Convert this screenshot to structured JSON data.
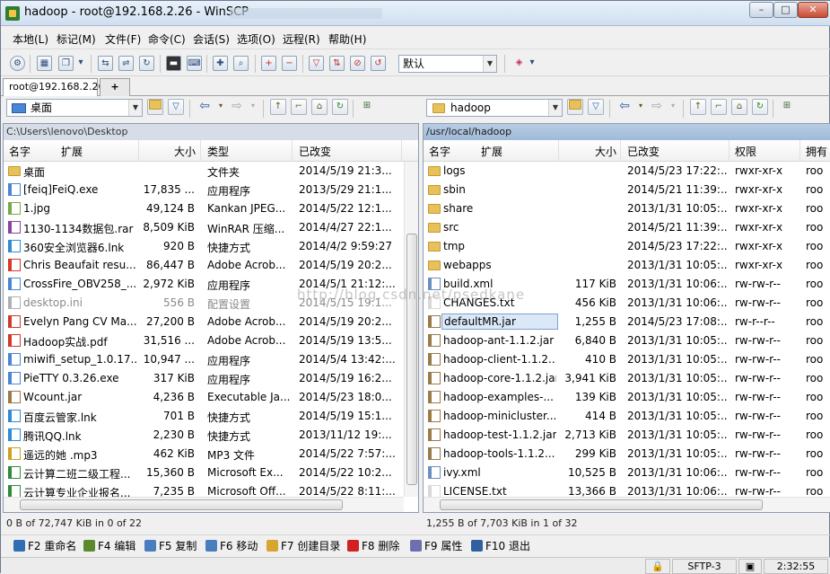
{
  "window": {
    "title": "hadoop - root@192.168.2.26 - WinSCP",
    "min": "–",
    "max": "□",
    "close": "✕"
  },
  "menu": [
    "本地(L)",
    "标记(M)",
    "文件(F)",
    "命令(C)",
    "会话(S)",
    "选项(O)",
    "远程(R)",
    "帮助(H)"
  ],
  "toolbar": {
    "transfer_setting": "默认"
  },
  "session_tab": {
    "label": "root@192.168.2.26",
    "new_tab": "+"
  },
  "left": {
    "drive": "桌面",
    "path": "C:\\Users\\lenovo\\Desktop",
    "columns": [
      "名字",
      "扩展",
      "大小",
      "类型",
      "已改变"
    ],
    "rows": [
      {
        "name": "桌面",
        "size": "",
        "type": "文件夹",
        "date": "2014/5/19  21:3...",
        "icon": "folder"
      },
      {
        "name": "[feiq]FeiQ.exe",
        "size": "17,835 ...",
        "type": "应用程序",
        "date": "2013/5/29  21:1...",
        "icon": "app"
      },
      {
        "name": "1.jpg",
        "size": "49,124 B",
        "type": "Kankan JPEG...",
        "date": "2014/5/22  12:1...",
        "icon": "image"
      },
      {
        "name": "1130-1134数据包.rar",
        "size": "8,509 KiB",
        "type": "WinRAR 压缩...",
        "date": "2014/4/27  22:1...",
        "icon": "rar"
      },
      {
        "name": "360安全浏览器6.lnk",
        "size": "920 B",
        "type": "快捷方式",
        "date": "2014/4/2  9:59:27",
        "icon": "lnk"
      },
      {
        "name": "Chris Beaufait resu...",
        "size": "86,447 B",
        "type": "Adobe Acrob...",
        "date": "2014/5/19  20:2...",
        "icon": "pdf"
      },
      {
        "name": "CrossFire_OBV258_...",
        "size": "2,972 KiB",
        "type": "应用程序",
        "date": "2014/5/1  21:12:...",
        "icon": "app"
      },
      {
        "name": "desktop.ini",
        "size": "556 B",
        "type": "配置设置",
        "date": "2014/5/15  19:1...",
        "icon": "ini",
        "hidden": true
      },
      {
        "name": "Evelyn Pang CV Ma...",
        "size": "27,200 B",
        "type": "Adobe Acrob...",
        "date": "2014/5/19  20:2...",
        "icon": "pdf"
      },
      {
        "name": "Hadoop实战.pdf",
        "size": "31,516 ...",
        "type": "Adobe Acrob...",
        "date": "2014/5/19  13:5...",
        "icon": "pdf"
      },
      {
        "name": "miwifi_setup_1.0.17...",
        "size": "10,947 ...",
        "type": "应用程序",
        "date": "2014/5/4  13:42:...",
        "icon": "app"
      },
      {
        "name": "PieTTY 0.3.26.exe",
        "size": "317 KiB",
        "type": "应用程序",
        "date": "2014/5/19  16:2...",
        "icon": "app"
      },
      {
        "name": "Wcount.jar",
        "size": "4,236 B",
        "type": "Executable Ja...",
        "date": "2014/5/23  18:0...",
        "icon": "jar"
      },
      {
        "name": "百度云管家.lnk",
        "size": "701 B",
        "type": "快捷方式",
        "date": "2014/5/19  15:1...",
        "icon": "lnk"
      },
      {
        "name": "腾讯QQ.lnk",
        "size": "2,230 B",
        "type": "快捷方式",
        "date": "2013/11/12  19:...",
        "icon": "lnk"
      },
      {
        "name": "遥远的她 .mp3",
        "size": "462 KiB",
        "type": "MP3 文件",
        "date": "2014/5/22  7:57:...",
        "icon": "mp3"
      },
      {
        "name": "云计算二班二级工程...",
        "size": "15,360 B",
        "type": "Microsoft Ex...",
        "date": "2014/5/22  10:2...",
        "icon": "xls"
      },
      {
        "name": "云计算专业企业报名...",
        "size": "7,235 B",
        "type": "Microsoft Off...",
        "date": "2014/5/22  8:11:...",
        "icon": "xls"
      }
    ],
    "status": "0 B of 72,747 KiB in 0 of 22"
  },
  "right": {
    "drive": "hadoop",
    "path": "/usr/local/hadoop",
    "columns": [
      "名字",
      "扩展",
      "大小",
      "已改变",
      "权限",
      "拥有"
    ],
    "rows": [
      {
        "name": "logs",
        "size": "",
        "date": "2014/5/23  17:22:...",
        "perm": "rwxr-xr-x",
        "owner": "roo",
        "icon": "folder"
      },
      {
        "name": "sbin",
        "size": "",
        "date": "2014/5/21  11:39:...",
        "perm": "rwxr-xr-x",
        "owner": "roo",
        "icon": "folder"
      },
      {
        "name": "share",
        "size": "",
        "date": "2013/1/31  10:05:...",
        "perm": "rwxr-xr-x",
        "owner": "roo",
        "icon": "folder"
      },
      {
        "name": "src",
        "size": "",
        "date": "2014/5/21  11:39:...",
        "perm": "rwxr-xr-x",
        "owner": "roo",
        "icon": "folder"
      },
      {
        "name": "tmp",
        "size": "",
        "date": "2014/5/23  17:22:...",
        "perm": "rwxr-xr-x",
        "owner": "roo",
        "icon": "folder"
      },
      {
        "name": "webapps",
        "size": "",
        "date": "2013/1/31  10:05:...",
        "perm": "rwxr-xr-x",
        "owner": "roo",
        "icon": "folder"
      },
      {
        "name": "build.xml",
        "size": "117 KiB",
        "date": "2013/1/31  10:06:...",
        "perm": "rw-rw-r--",
        "owner": "roo",
        "icon": "xml"
      },
      {
        "name": "CHANGES.txt",
        "size": "456 KiB",
        "date": "2013/1/31  10:06:...",
        "perm": "rw-rw-r--",
        "owner": "roo",
        "icon": "txt"
      },
      {
        "name": "defaultMR.jar",
        "size": "1,255 B",
        "date": "2014/5/23  17:08:...",
        "perm": "rw-r--r--",
        "owner": "roo",
        "icon": "jar",
        "selected": true
      },
      {
        "name": "hadoop-ant-1.1.2.jar",
        "size": "6,840 B",
        "date": "2013/1/31  10:05:...",
        "perm": "rw-rw-r--",
        "owner": "roo",
        "icon": "jar"
      },
      {
        "name": "hadoop-client-1.1.2...",
        "size": "410 B",
        "date": "2013/1/31  10:05:...",
        "perm": "rw-rw-r--",
        "owner": "roo",
        "icon": "jar"
      },
      {
        "name": "hadoop-core-1.1.2.jar",
        "size": "3,941 KiB",
        "date": "2013/1/31  10:05:...",
        "perm": "rw-rw-r--",
        "owner": "roo",
        "icon": "jar"
      },
      {
        "name": "hadoop-examples-...",
        "size": "139 KiB",
        "date": "2013/1/31  10:05:...",
        "perm": "rw-rw-r--",
        "owner": "roo",
        "icon": "jar"
      },
      {
        "name": "hadoop-minicluster...",
        "size": "414 B",
        "date": "2013/1/31  10:05:...",
        "perm": "rw-rw-r--",
        "owner": "roo",
        "icon": "jar"
      },
      {
        "name": "hadoop-test-1.1.2.jar",
        "size": "2,713 KiB",
        "date": "2013/1/31  10:05:...",
        "perm": "rw-rw-r--",
        "owner": "roo",
        "icon": "jar"
      },
      {
        "name": "hadoop-tools-1.1.2...",
        "size": "299 KiB",
        "date": "2013/1/31  10:05:...",
        "perm": "rw-rw-r--",
        "owner": "roo",
        "icon": "jar"
      },
      {
        "name": "ivy.xml",
        "size": "10,525 B",
        "date": "2013/1/31  10:06:...",
        "perm": "rw-rw-r--",
        "owner": "roo",
        "icon": "xml"
      },
      {
        "name": "LICENSE.txt",
        "size": "13,366 B",
        "date": "2013/1/31  10:06:...",
        "perm": "rw-rw-r--",
        "owner": "roo",
        "icon": "txt"
      }
    ],
    "status": "1,255 B of 7,703 KiB in 1 of 32"
  },
  "watermark": "http://blog.csdn.net/psedkane",
  "function_keys": [
    {
      "label": "F2 重命名",
      "icon": "rename-icon",
      "color": "#2f6db5"
    },
    {
      "label": "F4 编辑",
      "icon": "edit-icon",
      "color": "#5a8a2b"
    },
    {
      "label": "F5 复制",
      "icon": "copy-icon",
      "color": "#4a7dbd"
    },
    {
      "label": "F6 移动",
      "icon": "move-icon",
      "color": "#4a7dbd"
    },
    {
      "label": "F7 创建目录",
      "icon": "new-folder-icon",
      "color": "#d9a531"
    },
    {
      "label": "F8 删除",
      "icon": "delete-icon",
      "color": "#d02020"
    },
    {
      "label": "F9 属性",
      "icon": "properties-icon",
      "color": "#6f6fb0"
    },
    {
      "label": "F10 退出",
      "icon": "exit-icon",
      "color": "#3060a0"
    }
  ],
  "statusbar": {
    "protocol": "SFTP-3",
    "time": "2:32:55"
  },
  "icon_colors": {
    "folder": "#e8c15a",
    "app": "#4a86d6",
    "image": "#7aa84a",
    "rar": "#8e3fa0",
    "lnk": "#2f8bd6",
    "pdf": "#d23a2a",
    "ini": "#b0b0b0",
    "jar": "#9a7b4a",
    "mp3": "#d0a020",
    "xls": "#2e8b3a",
    "xml": "#6a8fc0",
    "txt": "#d8d8d8"
  }
}
